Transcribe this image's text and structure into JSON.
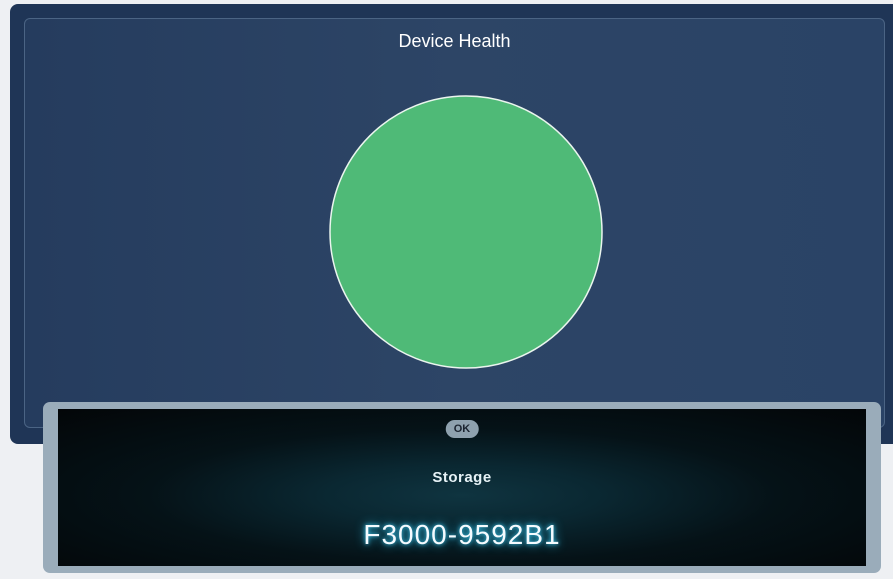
{
  "panel": {
    "title": "Device Health"
  },
  "health": {
    "status_color": "#4fba77",
    "outline_color": "#eaf5ee"
  },
  "card": {
    "status_badge": "OK",
    "label": "Storage",
    "device_id": "F3000-9592B1"
  }
}
